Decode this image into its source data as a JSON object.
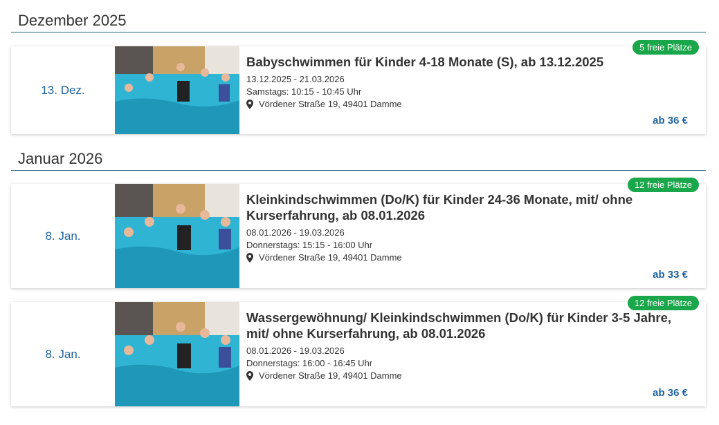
{
  "months": [
    {
      "heading": "Dezember 2025",
      "courses": [
        {
          "date": "13. Dez.",
          "badge": "5 freie Plätze",
          "title": "Babyschwimmen für Kinder 4-18 Monate (S), ab 13.12.2025",
          "period": "13.12.2025 - 21.03.2026",
          "schedule": "Samstags: 10:15 - 10:45 Uhr",
          "location": "Vördener Straße 19, 49401 Damme",
          "price": "ab 36 €"
        }
      ]
    },
    {
      "heading": "Januar 2026",
      "courses": [
        {
          "date": "8. Jan.",
          "badge": "12 freie Plätze",
          "title": "Kleinkindschwimmen (Do/K) für Kinder 24-36 Monate, mit/ ohne Kurserfahrung, ab 08.01.2026",
          "period": "08.01.2026 - 19.03.2026",
          "schedule": "Donnerstags: 15:15 - 16:00 Uhr",
          "location": "Vördener Straße 19, 49401 Damme",
          "price": "ab 33 €"
        },
        {
          "date": "8. Jan.",
          "badge": "12 freie Plätze",
          "title": "Wassergewöhnung/ Kleinkindschwimmen (Do/K) für Kinder 3-5 Jahre, mit/ ohne Kurserfahrung, ab 08.01.2026",
          "period": "08.01.2026 - 19.03.2026",
          "schedule": "Donnerstags: 16:00 - 16:45 Uhr",
          "location": "Vördener Straße 19, 49401 Damme",
          "price": "ab 36 €"
        }
      ]
    }
  ],
  "icons": {
    "location": "map-marker-icon"
  },
  "colors": {
    "accent": "#1e63a0",
    "badge": "#1aa64a",
    "divider": "#1e5f74"
  }
}
